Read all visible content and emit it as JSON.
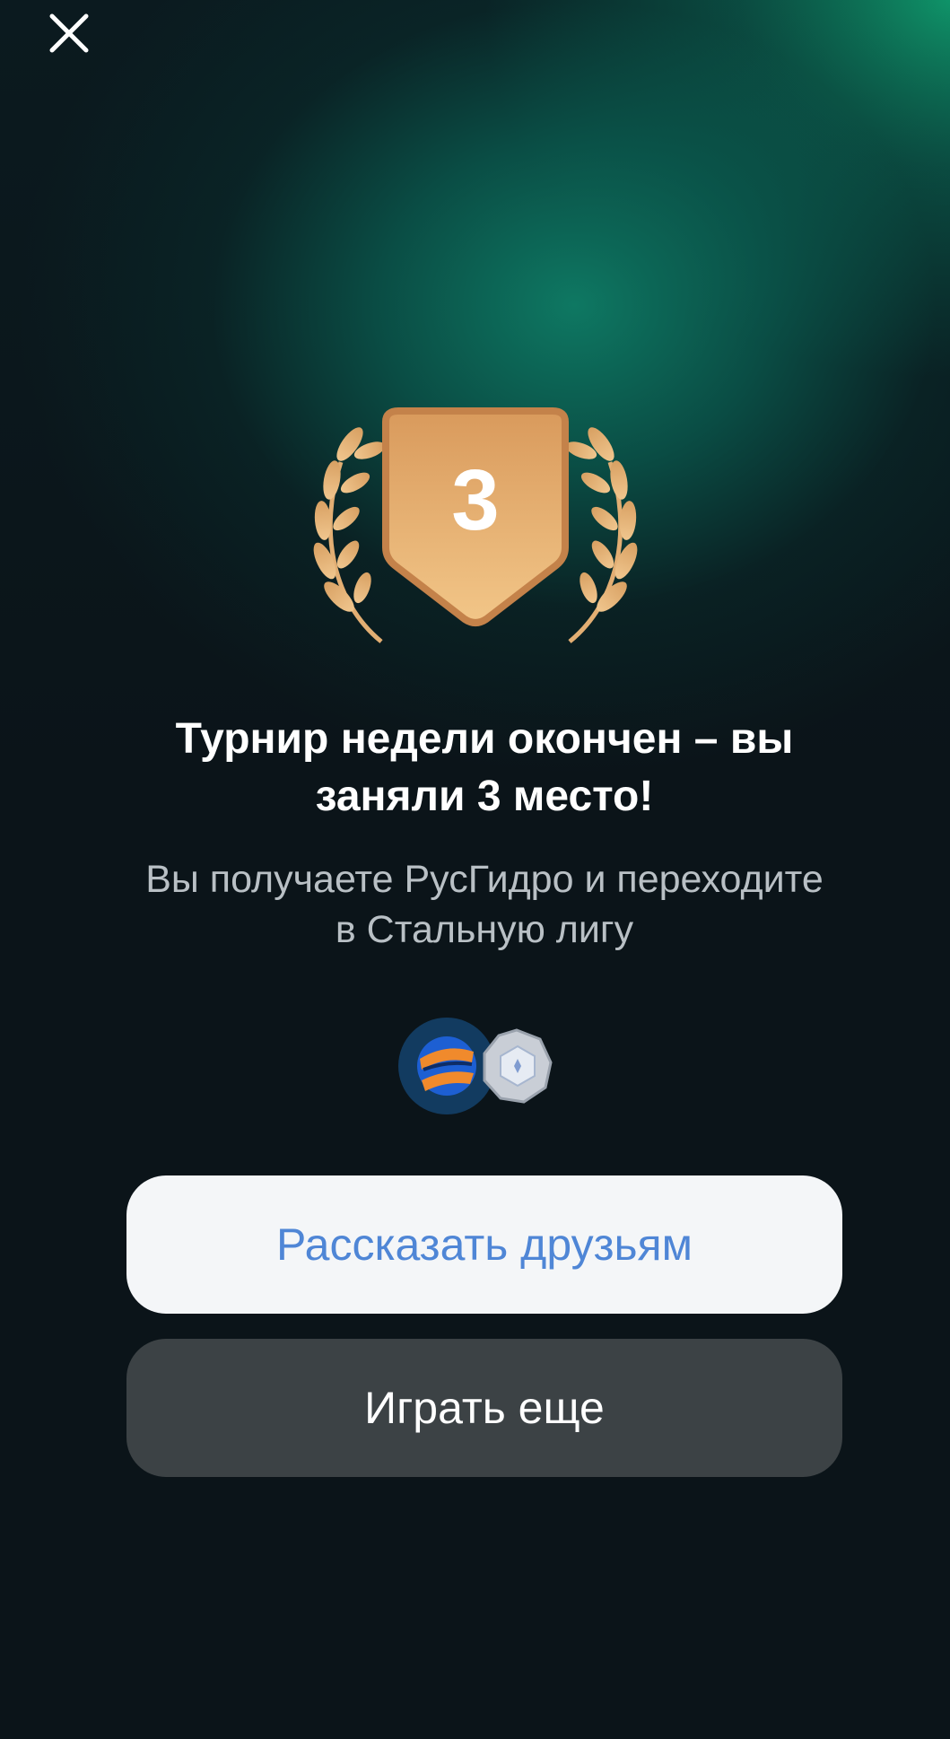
{
  "place": "3",
  "title": "Турнир недели окончен – вы заняли 3 место!",
  "subtitle": "Вы получаете РусГидро и переходите в Стальную лигу",
  "rewards": [
    {
      "icon": "rushydro-logo-icon"
    },
    {
      "icon": "steel-league-badge-icon"
    }
  ],
  "buttons": {
    "share_label": "Рассказать друзьям",
    "play_label": "Играть еще"
  },
  "colors": {
    "background": "#0b1419",
    "accent_green": "#0e7d66",
    "medal_gold": "#e8b071",
    "share_text": "#4f86d6",
    "play_button": "#3c4245"
  }
}
